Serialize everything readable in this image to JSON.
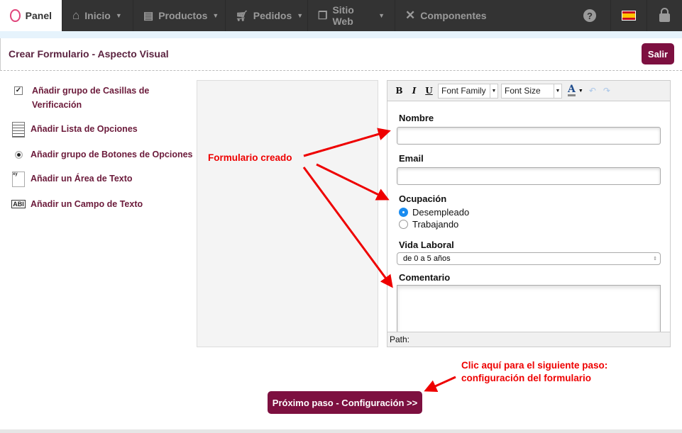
{
  "nav": {
    "items": [
      {
        "label": "Panel",
        "icon": "gauge-icon"
      },
      {
        "label": "Inicio",
        "icon": "home-icon"
      },
      {
        "label": "Productos",
        "icon": "products-icon"
      },
      {
        "label": "Pedidos",
        "icon": "cart-icon"
      },
      {
        "label": "Sitio Web",
        "icon": "pages-icon"
      },
      {
        "label": "Componentes",
        "icon": "tools-icon"
      }
    ],
    "help": "?",
    "lang": "es"
  },
  "header": {
    "title": "Crear Formulario - Aspecto Visual",
    "exit": "Salir"
  },
  "tools": [
    {
      "label": "Añadir grupo de Casillas de Verificación",
      "icon": "checkbox-icon"
    },
    {
      "label": "Añadir Lista de Opciones",
      "icon": "listbox-icon"
    },
    {
      "label": "Añadir grupo de Botones de Opciones",
      "icon": "radio-icon"
    },
    {
      "label": "Añadir un Área de Texto",
      "icon": "textarea-icon"
    },
    {
      "label": "Añadir un Campo de Texto",
      "icon": "textfield-icon"
    }
  ],
  "editor": {
    "bold": "B",
    "italic": "I",
    "underline": "U",
    "font_family": "Font Family",
    "font_size": "Font Size",
    "color": "A",
    "path": "Path:",
    "form": {
      "nombre": "Nombre",
      "email": "Email",
      "ocupacion": "Ocupación",
      "options": [
        "Desempleado",
        "Trabajando"
      ],
      "selected": "Desempleado",
      "vida": "Vida Laboral",
      "vida_value": "de 0 a 5 años",
      "comentario": "Comentario"
    }
  },
  "annotations": {
    "created": "Formulario creado",
    "next_line1": "Clic aquí para el siguiente paso:",
    "next_line2": "configuración del formulario",
    "color": "#e00000"
  },
  "next_button": "Próximo paso - Configuración >>"
}
